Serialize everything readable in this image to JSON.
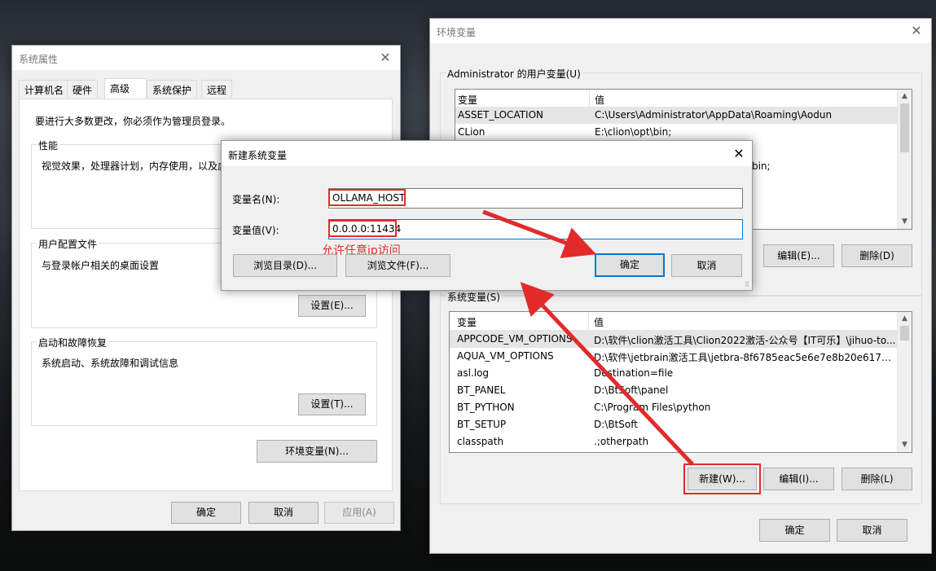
{
  "sys_props": {
    "title": "系统属性",
    "tabs": [
      "计算机名",
      "硬件",
      "高级",
      "系统保护",
      "远程"
    ],
    "admin_notice": "要进行大多数更改，你必须作为管理员登录。",
    "perf": {
      "label": "性能",
      "desc": "视觉效果，处理器计划，内存使用，以及虚"
    },
    "profile": {
      "label": "用户配置文件",
      "desc": "与登录帐户相关的桌面设置",
      "settings_btn": "设置(E)..."
    },
    "startup": {
      "label": "启动和故障恢复",
      "desc": "系统启动、系统故障和调试信息",
      "settings_btn": "设置(T)..."
    },
    "env_btn": "环境变量(N)...",
    "ok": "确定",
    "cancel": "取消",
    "apply": "应用(A)"
  },
  "env_vars": {
    "title": "环境变量",
    "user_group": "Administrator 的用户变量(U)",
    "col_var": "变量",
    "col_val": "值",
    "user_rows": [
      {
        "name": "ASSET_LOCATION",
        "value": "C:\\Users\\Administrator\\AppData\\Roaming\\Aodun"
      },
      {
        "name": "CLion",
        "value": "E:\\clion\\opt\\bin;"
      },
      {
        "name": "",
        "value": "bin;"
      }
    ],
    "user_edit_btn": "编辑(E)...",
    "user_delete_btn": "删除(D)",
    "sys_group": "系统变量(S)",
    "sys_rows": [
      {
        "name": "APPCODE_VM_OPTIONS",
        "value": "D:\\软件\\clion激活工具\\Clion2022激活-公众号【IT可乐】\\jihuo-to..."
      },
      {
        "name": "AQUA_VM_OPTIONS",
        "value": "D:\\软件\\jetbrain激活工具\\jetbra-8f6785eac5e6e7e8b20e6174d..."
      },
      {
        "name": "asl.log",
        "value": "Destination=file"
      },
      {
        "name": "BT_PANEL",
        "value": "D:\\BtSoft\\panel"
      },
      {
        "name": "BT_PYTHON",
        "value": "C:\\Program Files\\python"
      },
      {
        "name": "BT_SETUP",
        "value": "D:\\BtSoft"
      },
      {
        "name": "classpath",
        "value": ".;otherpath"
      }
    ],
    "new_btn": "新建(W)...",
    "edit_btn": "编辑(I)...",
    "delete_btn": "删除(L)",
    "ok": "确定",
    "cancel": "取消"
  },
  "new_var": {
    "title": "新建系统变量",
    "name_label": "变量名(N):",
    "name_value": "OLLAMA_HOST",
    "value_label": "变量值(V):",
    "value_value": "0.0.0.0:11434",
    "browse_dir": "浏览目录(D)...",
    "browse_file": "浏览文件(F)...",
    "ok": "确定",
    "cancel": "取消"
  },
  "annotation": {
    "text": "允许任意ip访问",
    "color": "#e12b2b"
  }
}
